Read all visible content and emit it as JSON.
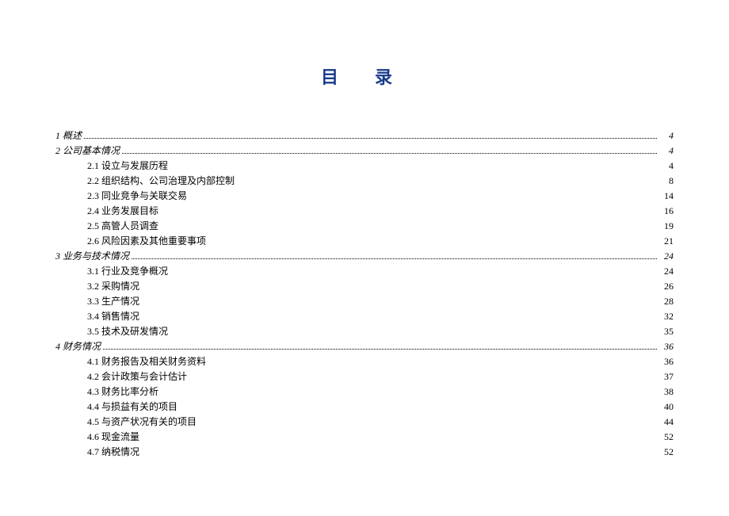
{
  "title": "目 录",
  "toc": [
    {
      "level": 1,
      "label": "1 概述",
      "page": "4",
      "dots": true
    },
    {
      "level": 1,
      "label": "2 公司基本情况",
      "page": "4",
      "dots": true
    },
    {
      "level": 2,
      "label": "2.1 设立与发展历程",
      "page": "4",
      "dots": false
    },
    {
      "level": 2,
      "label": "2.2 组织结构、公司治理及内部控制",
      "page": "8",
      "dots": false
    },
    {
      "level": 2,
      "label": "2.3 同业竞争与关联交易",
      "page": "14",
      "dots": false
    },
    {
      "level": 2,
      "label": "2.4 业务发展目标",
      "page": "16",
      "dots": false
    },
    {
      "level": 2,
      "label": "2.5 高管人员调查",
      "page": "19",
      "dots": false
    },
    {
      "level": 2,
      "label": "2.6 风险因素及其他重要事项",
      "page": "21",
      "dots": false
    },
    {
      "level": 1,
      "label": "3 业务与技术情况",
      "page": "24",
      "dots": true
    },
    {
      "level": 2,
      "label": "3.1 行业及竞争概况",
      "page": "24",
      "dots": false
    },
    {
      "level": 2,
      "label": "3.2 采购情况",
      "page": "26",
      "dots": false
    },
    {
      "level": 2,
      "label": "3.3 生产情况",
      "page": "28",
      "dots": false
    },
    {
      "level": 2,
      "label": "3.4 销售情况",
      "page": "32",
      "dots": false
    },
    {
      "level": 2,
      "label": "3.5 技术及研发情况",
      "page": "35",
      "dots": false
    },
    {
      "level": 1,
      "label": "4 财务情况",
      "page": "36",
      "dots": true
    },
    {
      "level": 2,
      "label": "4.1 财务报告及相关财务资料",
      "page": "36",
      "dots": false
    },
    {
      "level": 2,
      "label": "4.2 会计政策与会计估计",
      "page": "37",
      "dots": false
    },
    {
      "level": 2,
      "label": "4.3 财务比率分析",
      "page": "38",
      "dots": false
    },
    {
      "level": 2,
      "label": "4.4 与损益有关的项目",
      "page": "40",
      "dots": false
    },
    {
      "level": 2,
      "label": "4.5 与资产状况有关的项目",
      "page": "44",
      "dots": false
    },
    {
      "level": 2,
      "label": "4.6 现金流量",
      "page": "52",
      "dots": false
    },
    {
      "level": 2,
      "label": "4.7 纳税情况",
      "page": "52",
      "dots": false
    }
  ]
}
